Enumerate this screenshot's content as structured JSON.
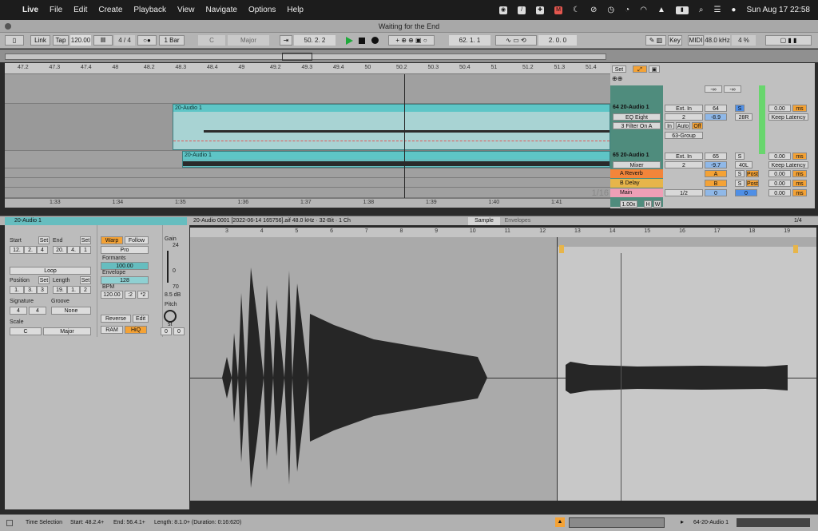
{
  "menubar": {
    "apple_icon": "apple-icon",
    "app": "Live",
    "items": [
      "File",
      "Edit",
      "Create",
      "Playback",
      "View",
      "Navigate",
      "Options",
      "Help"
    ],
    "datetime": "Sun Aug 17  22:58"
  },
  "window": {
    "title": "Waiting for the End"
  },
  "control_bar": {
    "link": "Link",
    "tap": "Tap",
    "tempo": "120.00",
    "time_sig": "4 / 4",
    "quantize": "1 Bar",
    "key_root": "C",
    "key_scale": "Major",
    "arrangement_position": "50.  2.  2",
    "loop_start": "62.  1.  1",
    "loop_length": "2.  0.  0",
    "key_label": "Key",
    "midi_label": "MIDI",
    "sample_rate": "48.0 kHz",
    "cpu": "4 %"
  },
  "ruler_ticks": [
    "47.2",
    "47.3",
    "47.4",
    "48",
    "48.2",
    "48.3",
    "48.4",
    "49",
    "49.2",
    "49.3",
    "49.4",
    "50",
    "50.2",
    "50.3",
    "50.4",
    "51",
    "51.2",
    "51.3",
    "51.4"
  ],
  "time_ticks": [
    "1:33",
    "1:34",
    "1:35",
    "1:36",
    "1:37",
    "1:38",
    "1:39",
    "1:40",
    "1:41"
  ],
  "arrangement": {
    "clip_top": "20-Audio 1",
    "clip_bottom": "20-Audio 1",
    "grid": "1/16"
  },
  "mixer": {
    "set_label": "Set",
    "tracks": [
      {
        "name": "64 20-Audio 1",
        "input": "Ext. In",
        "channel": "2",
        "device": "EQ Eight",
        "chain": "3 Filter On A",
        "group": "63-Group",
        "volume": "64",
        "pan": "-8.9",
        "pan2": "28R",
        "solo": "S",
        "latency": "0.00",
        "ms": "ms",
        "keep": "Keep Latency"
      },
      {
        "name": "65 20-Audio 1",
        "input": "Ext. In",
        "channel": "2",
        "device": "Mixer",
        "volume": "65",
        "pan": "-9.7",
        "pan2": "40L",
        "solo": "S",
        "latency": "0.00",
        "ms": "ms",
        "keep": "Keep Latency"
      },
      {
        "name": "A Reverb",
        "send": "A",
        "solo": "S",
        "post": "Post",
        "latency": "0.00",
        "ms": "ms"
      },
      {
        "name": "B Delay",
        "send": "B",
        "solo": "S",
        "post": "Post",
        "latency": "0.00",
        "ms": "ms"
      },
      {
        "name": "Main",
        "output": "1/2",
        "volume": "0",
        "pan": "0",
        "latency": "0.00",
        "ms": "ms"
      }
    ],
    "inf1": "-∞",
    "inf2": "-∞",
    "in": "In",
    "auto": "Auto",
    "off": "Off",
    "zoom": "1.00x",
    "h": "H",
    "w": "W"
  },
  "clip_view": {
    "clip_name": "20-Audio 1",
    "file_info": "20-Audio 0001 [2022-06-14 165756].aif  48.0 kHz · 32-Bit · 1 Ch",
    "tab_sample": "Sample",
    "tab_envelopes": "Envelopes",
    "page": "1/4",
    "start_label": "Start",
    "set1": "Set",
    "end_label": "End",
    "set2": "Set",
    "start_val": [
      "12.",
      "2.",
      "4"
    ],
    "end_val": [
      "20.",
      "4.",
      "1"
    ],
    "loop": "Loop",
    "position_label": "Position",
    "set3": "Set",
    "length_label": "Length",
    "set4": "Set",
    "position_val": [
      "1.",
      "3.",
      "3"
    ],
    "length_val": [
      "19.",
      "1.",
      "2"
    ],
    "signature_label": "Signature",
    "groove_label": "Groove",
    "sig_num": "4",
    "sig_den": "4",
    "groove_val": "None",
    "scale_label": "Scale",
    "scale_root": "C",
    "scale_mode": "Major",
    "warp": "Warp",
    "follow": "Follow",
    "warp_mode": "Pro",
    "formants_label": "Formants",
    "formants_val": "100.00",
    "envelope_label": "Envelope",
    "envelope_val": "128",
    "bpm_label": "BPM",
    "bpm_val": "120.00",
    "half": ":2",
    "double": "*2",
    "reverse": "Reverse",
    "edit": "Edit",
    "ram": "RAM",
    "hiq": "HiQ",
    "gain_label": "Gain",
    "gain_top": "24",
    "gain_mid": "0",
    "gain_bot": "70",
    "gain_db": "8.5 dB",
    "pitch_label": "Pitch",
    "pitch_unit": "st",
    "pitch_val": "0",
    "detune_val": "0"
  },
  "sample_ruler": [
    "3",
    "4",
    "5",
    "6",
    "7",
    "8",
    "9",
    "10",
    "11",
    "12",
    "13",
    "14",
    "15",
    "16",
    "17",
    "18",
    "19"
  ],
  "status": {
    "label": "Time Selection",
    "start": "Start: 48.2.4+",
    "end": "End: 56.4.1+",
    "length": "Length: 8.1.0+ (Duration: 0:16:620)",
    "track": "64-20-Audio 1"
  },
  "colors": {
    "clip": "#66bdbf",
    "accent": "#f4a235",
    "blue": "#4f8fe6",
    "play": "#1ea93a"
  }
}
